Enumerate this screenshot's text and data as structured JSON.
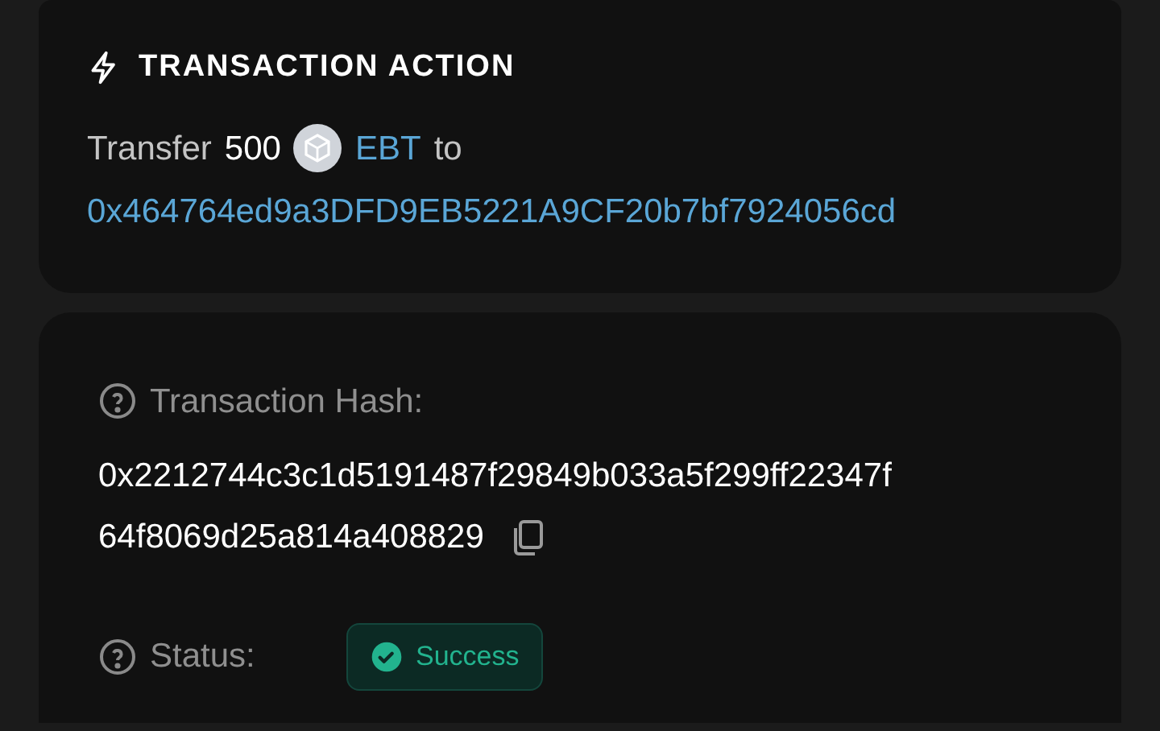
{
  "action_card": {
    "title": "TRANSACTION ACTION",
    "verb": "Transfer",
    "amount": "500",
    "token": "EBT",
    "preposition": "to",
    "recipient": "0x464764ed9a3DFD9EB5221A9CF20b7bf7924056cd"
  },
  "details_card": {
    "hash_label": "Transaction Hash:",
    "hash_lines": [
      "0x2212744c3c1d5191487f29849b033a5f299ff22347f",
      "64f8069d25a814a408829"
    ],
    "status_label": "Status:",
    "status": {
      "label": "Success",
      "kind": "success"
    }
  }
}
